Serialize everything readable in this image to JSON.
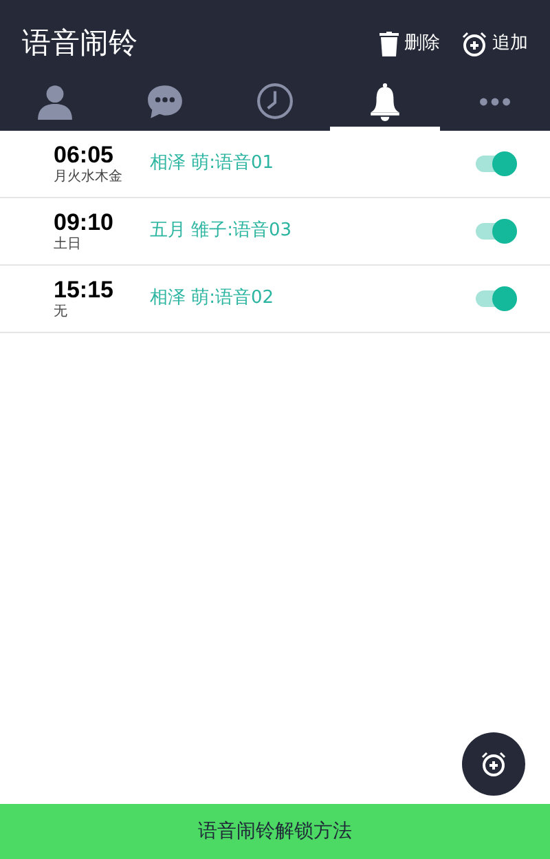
{
  "header": {
    "title": "语音闹铃",
    "actions": [
      {
        "kind": "delete",
        "label": "删除"
      },
      {
        "kind": "add",
        "label": "追加"
      }
    ]
  },
  "tabs": [
    {
      "kind": "person",
      "selected": false
    },
    {
      "kind": "chat",
      "selected": false
    },
    {
      "kind": "clock",
      "selected": false
    },
    {
      "kind": "bell",
      "selected": true
    },
    {
      "kind": "more",
      "selected": false
    }
  ],
  "alarms": [
    {
      "time": "06:05",
      "days": "月火水木金",
      "voice": "相泽 萌:语音01",
      "on": true
    },
    {
      "time": "09:10",
      "days": "土日",
      "voice": "五月 雏子:语音03",
      "on": true
    },
    {
      "time": "15:15",
      "days": "无",
      "voice": "相泽 萌:语音02",
      "on": true
    }
  ],
  "bottom_bar": {
    "label": "语音闹铃解锁方法"
  }
}
